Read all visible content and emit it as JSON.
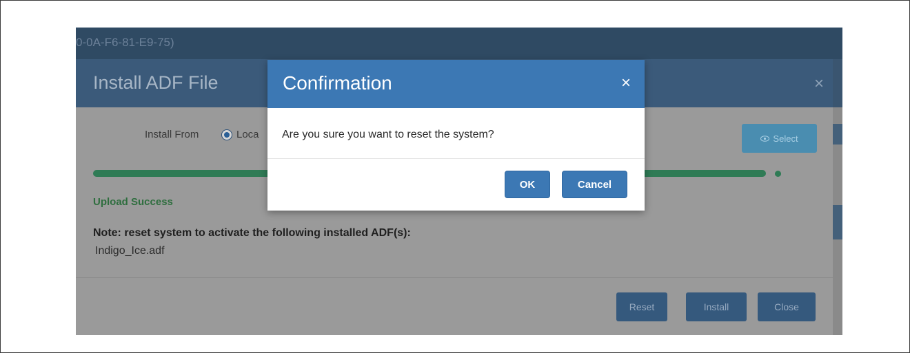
{
  "app_bar": {
    "title": "0-0A-F6-81-E9-75)"
  },
  "install_modal": {
    "title": "Install ADF File",
    "close_symbol": "×",
    "install_from_label": "Install From",
    "radio_label": "Loca",
    "select_label": "Select",
    "select_icon": "eye-icon",
    "upload_status": "Upload Success",
    "note": "Note: reset system to activate the following installed ADF(s):",
    "file_name": "Indigo_Ice.adf",
    "buttons": {
      "reset": "Reset",
      "install": "Install",
      "close": "Close"
    }
  },
  "confirmation": {
    "title": "Confirmation",
    "close_symbol": "×",
    "message": "Are you sure you want to reset the system?",
    "ok_label": "OK",
    "cancel_label": "Cancel"
  },
  "colors": {
    "confirmation_header": "#3c78b4",
    "button_primary": "#3c78b4",
    "progress": "#2f7b55",
    "success_text": "#2f6e3f"
  },
  "progress": {
    "fraction": 1.0
  }
}
